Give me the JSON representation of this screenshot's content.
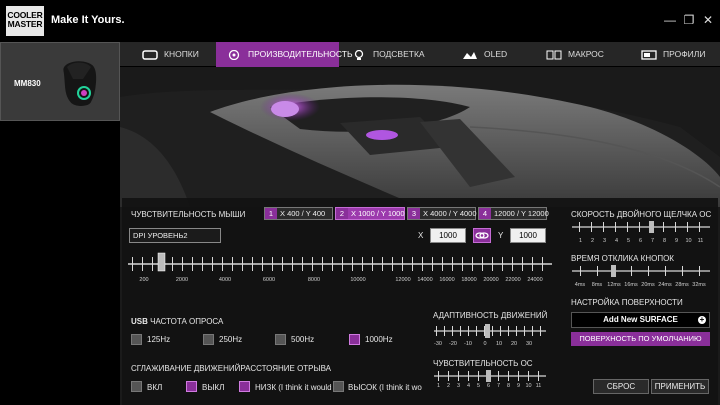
{
  "brand": {
    "logo_line1": "COOLER",
    "logo_line2": "MASTER",
    "tagline": "Make It Yours."
  },
  "window": {
    "minimize": "—",
    "restore": "❐",
    "close": "✕"
  },
  "device": {
    "name": "MM830"
  },
  "tabs": [
    {
      "label": "КНОПКИ",
      "icon": "keyboard-icon"
    },
    {
      "label": "ПРОИЗВОДИТЕЛЬНОСТЬ",
      "icon": "performance-icon"
    },
    {
      "label": "ПОДСВЕТКА",
      "icon": "lighting-icon"
    },
    {
      "label": "OLED",
      "icon": "oled-icon"
    },
    {
      "label": "МАКРОС",
      "icon": "macro-icon"
    },
    {
      "label": "ПРОФИЛИ",
      "icon": "profile-icon"
    }
  ],
  "sensitivity": {
    "title": "ЧУВСТВИТЕЛЬНОСТЬ МЫШИ",
    "levels": [
      {
        "num": "1",
        "label": "X 400 / Y 400"
      },
      {
        "num": "2",
        "label": "X 1000 / Y 1000"
      },
      {
        "num": "3",
        "label": "X 4000 / Y 4000"
      },
      {
        "num": "4",
        "label": "12000 / Y 12000"
      }
    ],
    "selected_level": 2,
    "dpi_select": "DPI УРОВЕНЬ2",
    "x_label": "X",
    "x_value": "1000",
    "y_label": "Y",
    "y_value": "1000",
    "scale": [
      "200",
      "2000",
      "4000",
      "6000",
      "8000",
      "10000",
      "12000",
      "14000",
      "16000",
      "18000",
      "20000",
      "22000",
      "24000"
    ]
  },
  "polling": {
    "title_prefix": "USB",
    "title": "ЧАСТОТА ОПРОСА",
    "options": [
      {
        "label": "125Hz",
        "checked": false
      },
      {
        "label": "250Hz",
        "checked": false
      },
      {
        "label": "500Hz",
        "checked": false
      },
      {
        "label": "1000Hz",
        "checked": true
      }
    ]
  },
  "smoothing": {
    "title": "СГЛАЖИВАНИЕ ДВИЖЕНИЙРАССТОЯНИЕ ОТРЫВА",
    "options": [
      {
        "label": "ВКЛ",
        "checked": false
      },
      {
        "label": "ВЫКЛ",
        "checked": true
      },
      {
        "label": "НИЗК (I think it would",
        "checked": true
      },
      {
        "label": "ВЫСОК (I think it wou",
        "checked": false
      }
    ]
  },
  "adaptive": {
    "title": "АДАПТИВНОСТЬ ДВИЖЕНИЙ",
    "scale": [
      "-30",
      "-20",
      "-10",
      "0",
      "10",
      "20",
      "30"
    ],
    "value": 0
  },
  "os_sensitivity": {
    "title": "ЧУВСТВИТЕЛЬНОСТЬ ОС",
    "scale": [
      "1",
      "2",
      "3",
      "4",
      "5",
      "6",
      "7",
      "8",
      "9",
      "10",
      "11"
    ],
    "value": 6
  },
  "double_click": {
    "title": "СКОРОСТЬ ДВОЙНОГО ЩЕЛЧКА ОС",
    "scale": [
      "1",
      "2",
      "3",
      "4",
      "5",
      "6",
      "7",
      "8",
      "9",
      "10",
      "11"
    ],
    "value": 6
  },
  "response": {
    "title": "ВРЕМЯ ОТКЛИКА КНОПОК",
    "scale": [
      "4ms",
      "8ms",
      "12ms",
      "16ms",
      "20ms",
      "24ms",
      "28ms",
      "32ms"
    ],
    "value": "16ms"
  },
  "surface": {
    "title": "НАСТРОЙКА ПОВЕРХНОСТИ",
    "add_label": "Add New SURFACE",
    "add_icon": "plus-icon",
    "default_label": "ПОВЕРХНОСТЬ ПО УМОЛЧАНИЮ"
  },
  "actions": {
    "reset": "СБРОС",
    "apply": "ПРИМЕНИТЬ"
  },
  "colors": {
    "accent": "#8a2f9a",
    "background": "#121212"
  }
}
